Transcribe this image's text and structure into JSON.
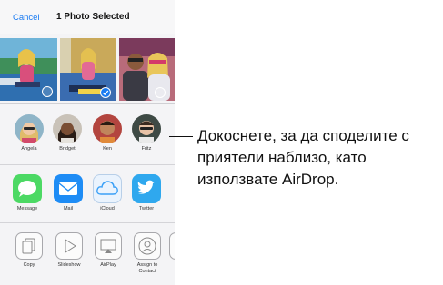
{
  "nav": {
    "cancel_label": "Cancel",
    "title": "1 Photo Selected"
  },
  "photos": [
    {
      "selected": false
    },
    {
      "selected": true
    },
    {
      "selected": false
    }
  ],
  "people": [
    {
      "name": "Angela"
    },
    {
      "name": "Bridget"
    },
    {
      "name": "Ken"
    },
    {
      "name": "Fritz"
    }
  ],
  "apps": [
    {
      "name": "Message",
      "icon": "speech-bubble-icon",
      "color": "#4cd964"
    },
    {
      "name": "Mail",
      "icon": "envelope-icon",
      "color": "#1e8cf5"
    },
    {
      "name": "iCloud",
      "icon": "cloud-icon",
      "color": "#3aa0f7"
    },
    {
      "name": "Twitter",
      "icon": "bird-icon",
      "color": "#2fa8ee"
    }
  ],
  "actions": [
    {
      "name": "Copy",
      "icon": "copy-icon"
    },
    {
      "name": "Slideshow",
      "icon": "play-icon"
    },
    {
      "name": "AirPlay",
      "icon": "airplay-icon"
    },
    {
      "name": "Assign to Contact",
      "icon": "contact-icon"
    }
  ],
  "callout": {
    "text": "Докоснете, за да споделите с приятели наблизо, като използвате AirDrop."
  },
  "colors": {
    "accent": "#1a7bf2"
  }
}
